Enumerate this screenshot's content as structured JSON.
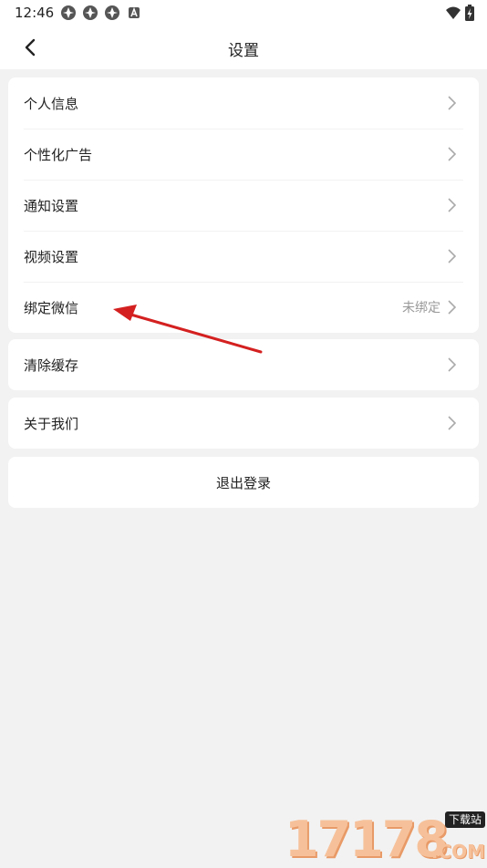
{
  "status_bar": {
    "time": "12:46",
    "notification_icons": [
      "app-icon",
      "app-icon",
      "app-icon",
      "a-badge-icon"
    ],
    "right_icons": [
      "wifi-icon",
      "battery-charging-icon"
    ]
  },
  "header": {
    "title": "设置",
    "back_icon": "chevron-left-icon"
  },
  "groups": [
    {
      "items": [
        {
          "label": "个人信息",
          "value": ""
        },
        {
          "label": "个性化广告",
          "value": ""
        },
        {
          "label": "通知设置",
          "value": ""
        },
        {
          "label": "视频设置",
          "value": ""
        },
        {
          "label": "绑定微信",
          "value": "未绑定"
        }
      ]
    },
    {
      "items": [
        {
          "label": "清除缓存",
          "value": ""
        }
      ]
    },
    {
      "items": [
        {
          "label": "关于我们",
          "value": ""
        }
      ]
    }
  ],
  "logout": {
    "label": "退出登录"
  },
  "watermark": {
    "digits": "17178",
    "badge": "下载站",
    "suffix": ".COM"
  },
  "colors": {
    "background": "#f2f2f2",
    "card": "#ffffff",
    "text": "#222222",
    "secondary_text": "#999999",
    "annotation_arrow": "#d42020",
    "watermark": "#f6c19a"
  }
}
